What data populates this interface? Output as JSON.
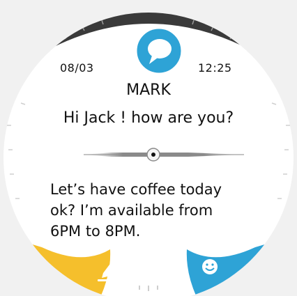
{
  "message": {
    "date": "08/03",
    "time": "12:25",
    "sender": "MARK",
    "preview": "Hi Jack ! how are you?",
    "body_lines": [
      "Let’s have coffee today",
      "ok? I’m available from",
      "6PM to 8PM."
    ]
  },
  "icons": {
    "top": "chat-bubble-icon",
    "reply": "pencil-icon",
    "emoji": "smiley-icon"
  },
  "colors": {
    "accent_blue": "#2ea3d6",
    "accent_yellow": "#f5bf2c",
    "bezel_dark": "#3a3a3a"
  }
}
